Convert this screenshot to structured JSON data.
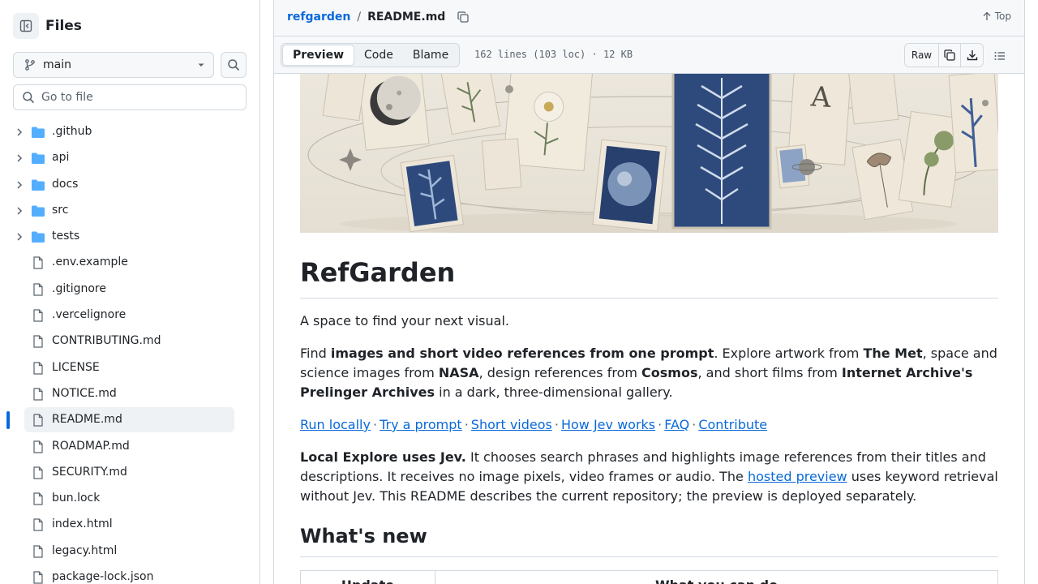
{
  "sidebar": {
    "title": "Files",
    "branch": "main",
    "goto_placeholder": "Go to file",
    "items": [
      {
        "name": ".github",
        "type": "folder"
      },
      {
        "name": "api",
        "type": "folder"
      },
      {
        "name": "docs",
        "type": "folder"
      },
      {
        "name": "src",
        "type": "folder"
      },
      {
        "name": "tests",
        "type": "folder"
      },
      {
        "name": ".env.example",
        "type": "file"
      },
      {
        "name": ".gitignore",
        "type": "file"
      },
      {
        "name": ".vercelignore",
        "type": "file"
      },
      {
        "name": "CONTRIBUTING.md",
        "type": "file"
      },
      {
        "name": "LICENSE",
        "type": "file"
      },
      {
        "name": "NOTICE.md",
        "type": "file"
      },
      {
        "name": "README.md",
        "type": "file",
        "selected": true
      },
      {
        "name": "ROADMAP.md",
        "type": "file"
      },
      {
        "name": "SECURITY.md",
        "type": "file"
      },
      {
        "name": "bun.lock",
        "type": "file"
      },
      {
        "name": "index.html",
        "type": "file"
      },
      {
        "name": "legacy.html",
        "type": "file"
      },
      {
        "name": "package-lock.json",
        "type": "file"
      }
    ]
  },
  "header": {
    "repo": "refgarden",
    "separator": "/",
    "file": "README.md",
    "top_label": "Top"
  },
  "toolbar": {
    "tabs": [
      {
        "label": "Preview",
        "active": true
      },
      {
        "label": "Code",
        "active": false
      },
      {
        "label": "Blame",
        "active": false
      }
    ],
    "file_meta": "162 lines (103 loc) · 12 KB",
    "raw_label": "Raw"
  },
  "readme": {
    "title": "RefGarden",
    "tagline": "A space to find your next visual.",
    "p1": {
      "t1": "Find ",
      "b1": "images and short video references from one prompt",
      "t2": ". Explore artwork from ",
      "b2": "The Met",
      "t3": ", space and science images from ",
      "b3": "NASA",
      "t4": ", design references from ",
      "b4": "Cosmos",
      "t5": ", and short films from ",
      "b5": "Internet Archive's Prelinger Archives",
      "t6": " in a dark, three-dimensional gallery."
    },
    "links": [
      "Run locally",
      "Try a prompt",
      "Short videos",
      "How Jev works",
      "FAQ",
      "Contribute"
    ],
    "link_separator": "·",
    "p2": {
      "b1": "Local Explore uses Jev.",
      "t1": " It chooses search phrases and highlights image references from their titles and descriptions. It receives no image pixels, video frames or audio. The ",
      "link": "hosted preview",
      "t2": " uses keyword retrieval without Jev. This README describes the current repository; the preview is deployed separately."
    },
    "whats_new": "What's new",
    "table_headers": [
      "Update",
      "What you can do"
    ]
  },
  "colors": {
    "accent": "#0969da",
    "text": "#1f2328",
    "muted": "#59636e",
    "border": "#d1d9e0",
    "folder": "#54aeff",
    "hero_bg": "#e9e4da",
    "cyanotype": "#2e4a7d"
  }
}
